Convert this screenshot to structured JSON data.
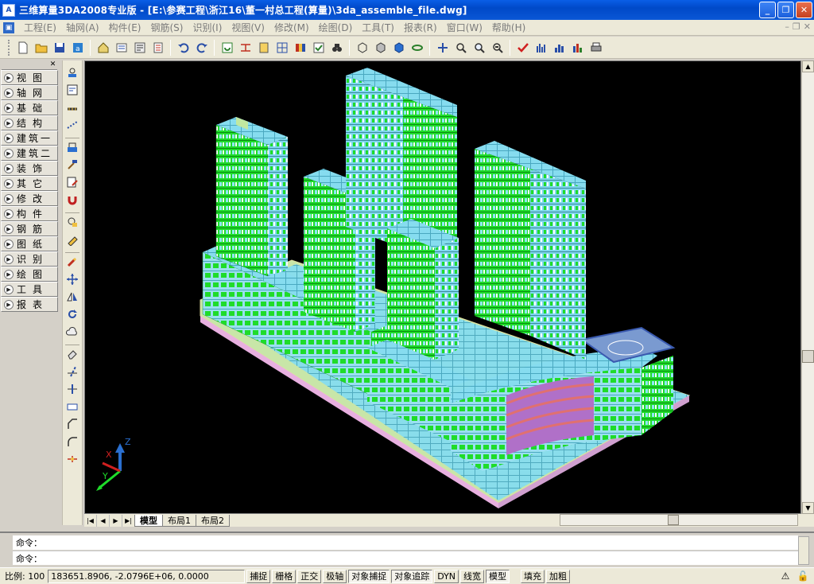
{
  "window": {
    "title": "三维算量3DA2008专业版 - [E:\\参赛工程\\浙江16\\董一村总工程(算量)\\3da_assemble_file.dwg]",
    "app_icon_text": "A"
  },
  "menu": {
    "items": [
      "工程(E)",
      "轴网(A)",
      "构件(E)",
      "钢筋(S)",
      "识别(I)",
      "视图(V)",
      "修改(M)",
      "绘图(D)",
      "工具(T)",
      "报表(R)",
      "窗口(W)",
      "帮助(H)"
    ]
  },
  "left_panel": {
    "items": [
      "视图",
      "轴网",
      "基础",
      "结构",
      "建筑一",
      "建筑二",
      "装饰",
      "其它",
      "修改",
      "构件",
      "钢筋",
      "图纸",
      "识别",
      "绘图",
      "工具",
      "报表"
    ]
  },
  "ucs": {
    "x_label": "X",
    "y_label": "Y",
    "z_label": "Z"
  },
  "tabs": {
    "items": [
      "模型",
      "布局1",
      "布局2"
    ],
    "active": "模型"
  },
  "command": {
    "line1": "命令：",
    "line2": "命令："
  },
  "status": {
    "scale_label": "比例: 100",
    "coords": "183651.8906, -2.0796E+06, 0.0000",
    "toggles": [
      {
        "label": "捕捉",
        "on": false
      },
      {
        "label": "栅格",
        "on": false
      },
      {
        "label": "正交",
        "on": false
      },
      {
        "label": "极轴",
        "on": false
      },
      {
        "label": "对象捕捉",
        "on": true
      },
      {
        "label": "对象追踪",
        "on": true
      },
      {
        "label": "DYN",
        "on": false
      },
      {
        "label": "线宽",
        "on": false
      },
      {
        "label": "模型",
        "on": true
      }
    ],
    "extra": [
      "填充",
      "加粗"
    ]
  },
  "colors": {
    "viewport_bg": "#000000",
    "wall_green": "#1fdc2a",
    "slab_cyan": "#7fe0f0",
    "ground": "#c8e0a0"
  }
}
